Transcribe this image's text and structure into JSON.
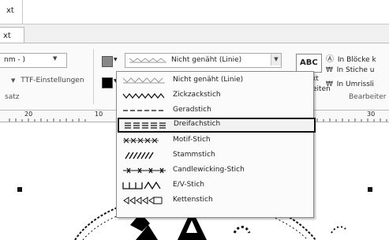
{
  "title_tab": "xt",
  "ribbon_tab": "xt",
  "font_select": {
    "value": "nm - )"
  },
  "ttf_settings": "TTF-Einstellungen",
  "satz_group": "satz",
  "stitch_select": {
    "value": "Nicht genäht (Linie)"
  },
  "abc_button": "ABC",
  "ext_label": "xt",
  "eiten_label": "eiten",
  "convert": {
    "blocks": "In Blöcke k",
    "stitches": "In Stiche u",
    "outline": "In Umrissli"
  },
  "bearbeiten_group": "Bearbeiter",
  "ruler": {
    "labels": [
      "20",
      "10",
      "30"
    ]
  },
  "stitch_menu": [
    {
      "label": "Nicht genäht (Linie)",
      "icon": "not-sewn-line-icon"
    },
    {
      "label": "Zickzackstich",
      "icon": "zigzag-stitch-icon"
    },
    {
      "label": "Geradstich",
      "icon": "running-stitch-icon"
    },
    {
      "label": "Dreifachstich",
      "icon": "triple-stitch-icon",
      "selected": true
    },
    {
      "label": "Motif-Stich",
      "icon": "motif-stitch-icon"
    },
    {
      "label": "Stammstich",
      "icon": "stem-stitch-icon"
    },
    {
      "label": "Candlewicking-Stich",
      "icon": "candlewicking-stitch-icon"
    },
    {
      "label": "E/V-Stich",
      "icon": "ev-stitch-icon"
    },
    {
      "label": "Kettenstich",
      "icon": "chain-stitch-icon"
    }
  ]
}
